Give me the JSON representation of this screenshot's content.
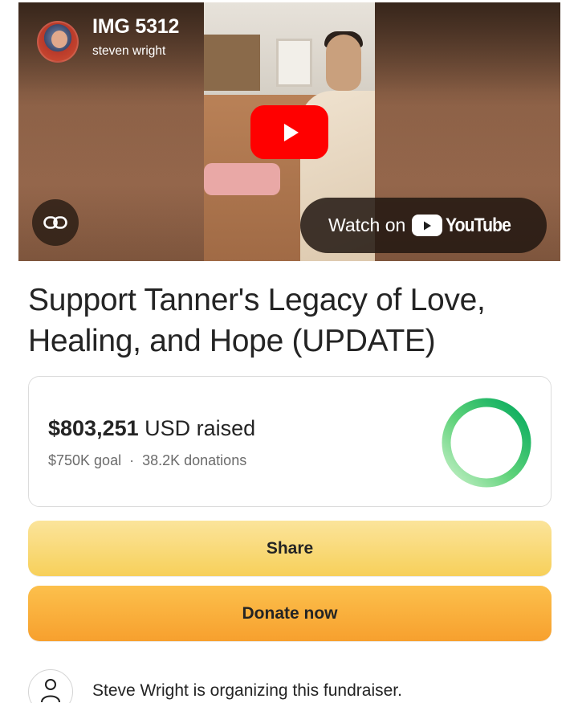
{
  "video": {
    "title": "IMG 5312",
    "channel": "steven wright",
    "watch_label": "Watch on",
    "youtube_wordmark": "YouTube",
    "icons": [
      "play-icon",
      "link-icon",
      "youtube-logo-icon"
    ],
    "accent": "#ff0000"
  },
  "page": {
    "title": "Support Tanner's Legacy of Love, Healing, and Hope (UPDATE)"
  },
  "progress": {
    "amount": "$803,251",
    "currency_raised": "USD raised",
    "goal": "$750K goal",
    "separator": "·",
    "donations": "38.2K donations",
    "ring_fraction": 1.0,
    "ring_color": "#02a95c"
  },
  "actions": {
    "share_label": "Share",
    "donate_label": "Donate now",
    "share_color": "#f7d05a",
    "donate_color": "#f7a02e"
  },
  "organizer": {
    "text": "Steve Wright is organizing this fundraiser.",
    "icon": "user-icon"
  }
}
